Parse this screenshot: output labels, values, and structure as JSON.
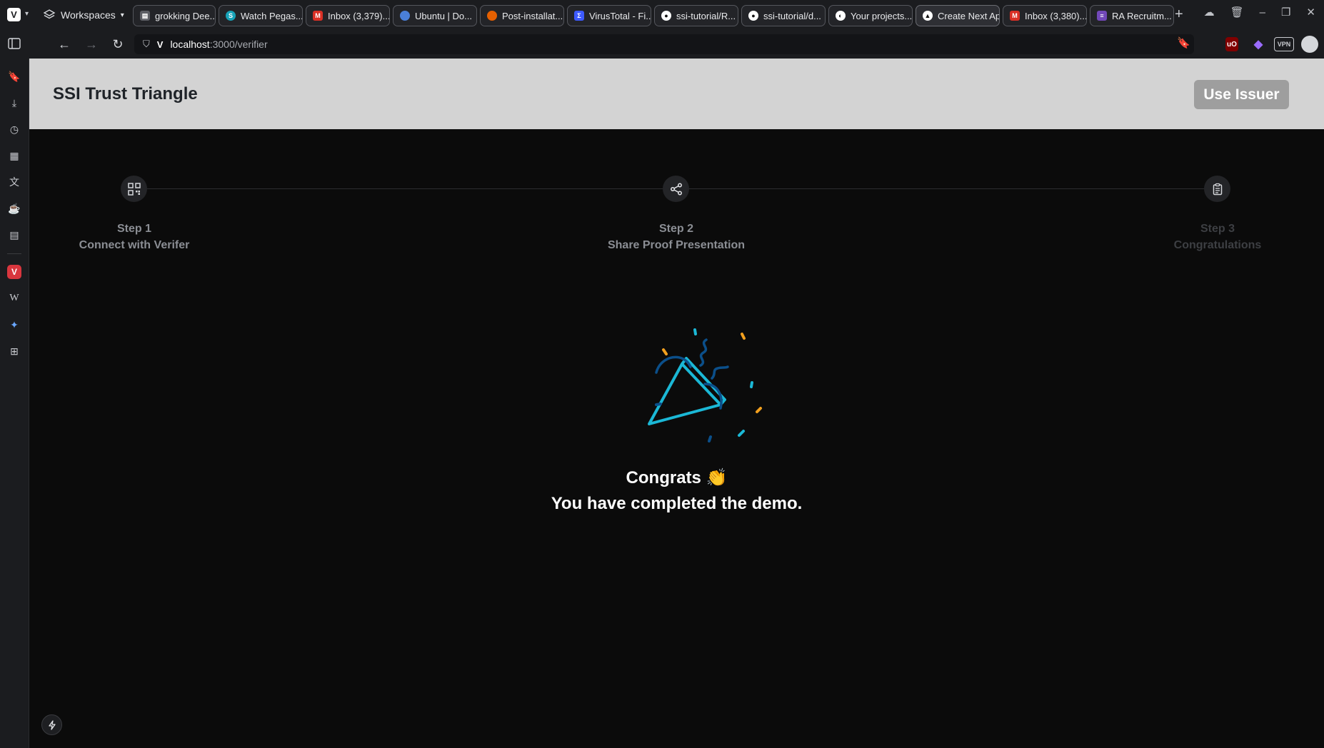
{
  "browser": {
    "workspaces_label": "Workspaces",
    "tabs": [
      {
        "label": "grokking Dee...",
        "favicon": "doc-icon",
        "color": "#8a8c92"
      },
      {
        "label": "Watch Pegas...",
        "favicon": "s-icon",
        "color": "#17a2b8"
      },
      {
        "label": "Inbox (3,379)...",
        "favicon": "gmail-icon",
        "color": "#d93025"
      },
      {
        "label": "Ubuntu | Do...",
        "favicon": "globe-icon",
        "color": "#4a7fd8"
      },
      {
        "label": "Post-installat...",
        "favicon": "firefox-icon",
        "color": "#e66000"
      },
      {
        "label": "VirusTotal - Fi...",
        "favicon": "virustotal-icon",
        "color": "#3d5afe"
      },
      {
        "label": "ssi-tutorial/R...",
        "favicon": "github-icon",
        "color": "#ffffff"
      },
      {
        "label": "ssi-tutorial/d...",
        "favicon": "github-icon",
        "color": "#ffffff"
      },
      {
        "label": "Your projects...",
        "favicon": "project-icon",
        "color": "#ffffff"
      },
      {
        "label": "Create Next Ap",
        "favicon": "next-icon",
        "color": "#ffffff"
      },
      {
        "label": "Inbox (3,380)...",
        "favicon": "gmail-icon",
        "color": "#d93025"
      },
      {
        "label": "RA Recruitm...",
        "favicon": "forms-icon",
        "color": "#7248b9"
      }
    ],
    "url_host": "localhost",
    "url_path": ":3000/verifier",
    "vpn_label": "VPN",
    "ublock_label": "uO"
  },
  "page": {
    "site_title": "SSI Trust Triangle",
    "use_issuer_label": "Use Issuer",
    "steps": [
      {
        "title": "Step 1",
        "subtitle": "Connect with Verifer",
        "icon": "qr-code-icon",
        "state": "done"
      },
      {
        "title": "Step 2",
        "subtitle": "Share Proof Presentation",
        "icon": "share-icon",
        "state": "done"
      },
      {
        "title": "Step 3",
        "subtitle": "Congratulations",
        "icon": "clipboard-icon",
        "state": "inactive"
      }
    ],
    "congrats_line": "Congrats 👏",
    "completed_line": "You have completed the demo.",
    "accent_colors": {
      "cyan": "#1bb8d6",
      "blue": "#0b4f8a",
      "orange": "#f2a01e"
    }
  }
}
